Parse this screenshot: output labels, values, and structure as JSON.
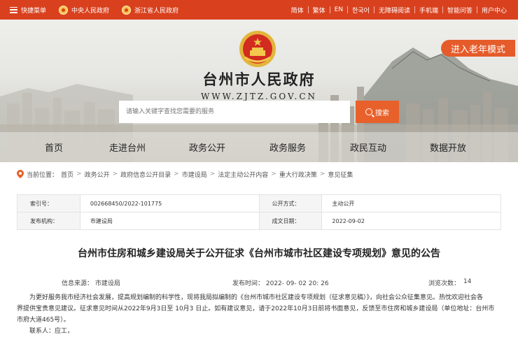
{
  "topbar": {
    "left": [
      {
        "label": "快捷菜单",
        "icon": "menu-icon"
      },
      {
        "label": "中央人民政府",
        "icon": "national-emblem-icon"
      },
      {
        "label": "浙江省人民政府",
        "icon": "provincial-emblem-icon"
      }
    ],
    "right": [
      "简体",
      "繁体",
      "EN",
      "한국어",
      "无障碍阅读",
      "手机端",
      "智能问答",
      "用户中心"
    ]
  },
  "header": {
    "title": "台州市人民政府",
    "url": "WWW.ZJTZ.GOV.CN",
    "elder_mode": "进入老年模式"
  },
  "search": {
    "placeholder": "请输入关键字查找您需要的服务",
    "button": "搜索"
  },
  "nav": [
    "首页",
    "走进台州",
    "政务公开",
    "政务服务",
    "政民互动",
    "数据开放"
  ],
  "breadcrumb": {
    "prefix": "当前位置：",
    "items": [
      "首页",
      "政务公开",
      "政府信息公开目录",
      "市建设局",
      "法定主动公开内容",
      "重大行政决策",
      "意见征集"
    ]
  },
  "info": {
    "index_label": "索引号：",
    "index_value": "002668450/2022-101775",
    "mode_label": "公开方式：",
    "mode_value": "主动公开",
    "org_label": "发布机构：",
    "org_value": "市建设局",
    "date_label": "成文日期：",
    "date_value": "2022-09-02"
  },
  "article": {
    "title": "台州市住房和城乡建设局关于公开征求《台州市城市社区建设专项规划》意见的公告",
    "source": "信息来源：  市建设局",
    "time": "发布时间：  2022- 09- 02 20: 26",
    "views_label": "浏览次数：",
    "views": "14",
    "para1_line1": "为更好服务我市经济社会发展，提高规划编制的科学性，现将我局拟编制的《台州市城市社区建设专项规划（征求意见稿）》，向社会公众征集意见。热忱欢迎社会各",
    "para1_line2": "界提供宝贵意见建议。征求意见时间从2022年9月3日至 10月3 日止。如有建议意见，请于2022年10月3日前将书面意见，反馈至市住房和城乡建设局（单位地址：台州市",
    "para1_line3": "市府大道465号）。",
    "contact": "联系人：应工，"
  },
  "colors": {
    "topbar": "#d9411e",
    "accent": "#e8602a"
  }
}
